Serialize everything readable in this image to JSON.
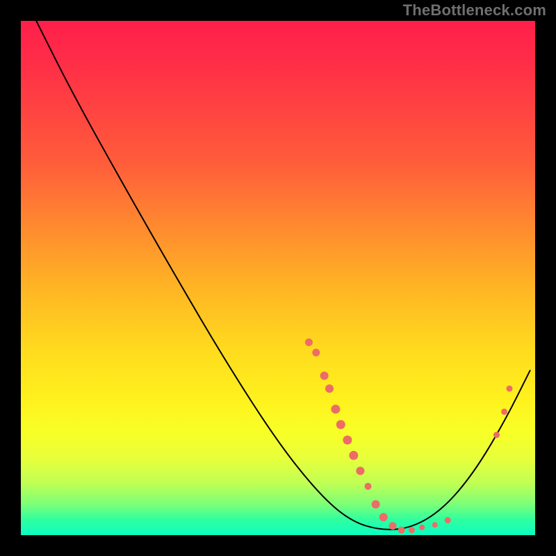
{
  "attribution": "TheBottleneck.com",
  "chart_data": {
    "type": "line",
    "title": "",
    "xlabel": "",
    "ylabel": "",
    "xlim": [
      0,
      100
    ],
    "ylim": [
      0,
      100
    ],
    "curve": [
      {
        "x": 3.0,
        "y": 100.0
      },
      {
        "x": 10.0,
        "y": 86.0
      },
      {
        "x": 20.0,
        "y": 68.0
      },
      {
        "x": 30.0,
        "y": 50.5
      },
      {
        "x": 40.0,
        "y": 33.5
      },
      {
        "x": 50.0,
        "y": 18.0
      },
      {
        "x": 58.0,
        "y": 8.0
      },
      {
        "x": 64.0,
        "y": 2.8
      },
      {
        "x": 70.0,
        "y": 0.9
      },
      {
        "x": 76.0,
        "y": 1.4
      },
      {
        "x": 82.0,
        "y": 5.0
      },
      {
        "x": 88.0,
        "y": 12.0
      },
      {
        "x": 94.0,
        "y": 22.0
      },
      {
        "x": 99.0,
        "y": 32.0
      }
    ],
    "marker_clusters": [
      {
        "points": [
          {
            "x": 56.0,
            "y": 37.5,
            "r": 5.5
          },
          {
            "x": 57.4,
            "y": 35.5,
            "r": 5.5
          },
          {
            "x": 59.0,
            "y": 31.0,
            "r": 6.0
          },
          {
            "x": 60.0,
            "y": 28.5,
            "r": 6.0
          },
          {
            "x": 61.2,
            "y": 24.5,
            "r": 6.5
          },
          {
            "x": 62.2,
            "y": 21.5,
            "r": 6.5
          },
          {
            "x": 63.5,
            "y": 18.5,
            "r": 6.5
          },
          {
            "x": 64.7,
            "y": 15.5,
            "r": 6.5
          },
          {
            "x": 66.0,
            "y": 12.5,
            "r": 6.0
          },
          {
            "x": 67.5,
            "y": 9.5,
            "r": 5.0
          },
          {
            "x": 69.0,
            "y": 6.0,
            "r": 6.0
          },
          {
            "x": 70.5,
            "y": 3.5,
            "r": 6.0
          },
          {
            "x": 72.3,
            "y": 1.8,
            "r": 5.5
          },
          {
            "x": 74.0,
            "y": 1.0,
            "r": 5.0
          },
          {
            "x": 76.0,
            "y": 1.0,
            "r": 4.5
          },
          {
            "x": 78.0,
            "y": 1.5,
            "r": 4.0
          },
          {
            "x": 80.5,
            "y": 2.0,
            "r": 4.0
          },
          {
            "x": 83.0,
            "y": 2.9,
            "r": 4.5
          },
          {
            "x": 92.5,
            "y": 19.5,
            "r": 4.5
          },
          {
            "x": 94.0,
            "y": 24.0,
            "r": 4.5
          },
          {
            "x": 95.0,
            "y": 28.5,
            "r": 4.5
          }
        ]
      }
    ],
    "colors": {
      "curve": "#000000",
      "markers": "#ec6c66",
      "gradient_top": "#ff1f4a",
      "gradient_mid": "#fff21e",
      "gradient_bottom": "#0affc2"
    }
  }
}
